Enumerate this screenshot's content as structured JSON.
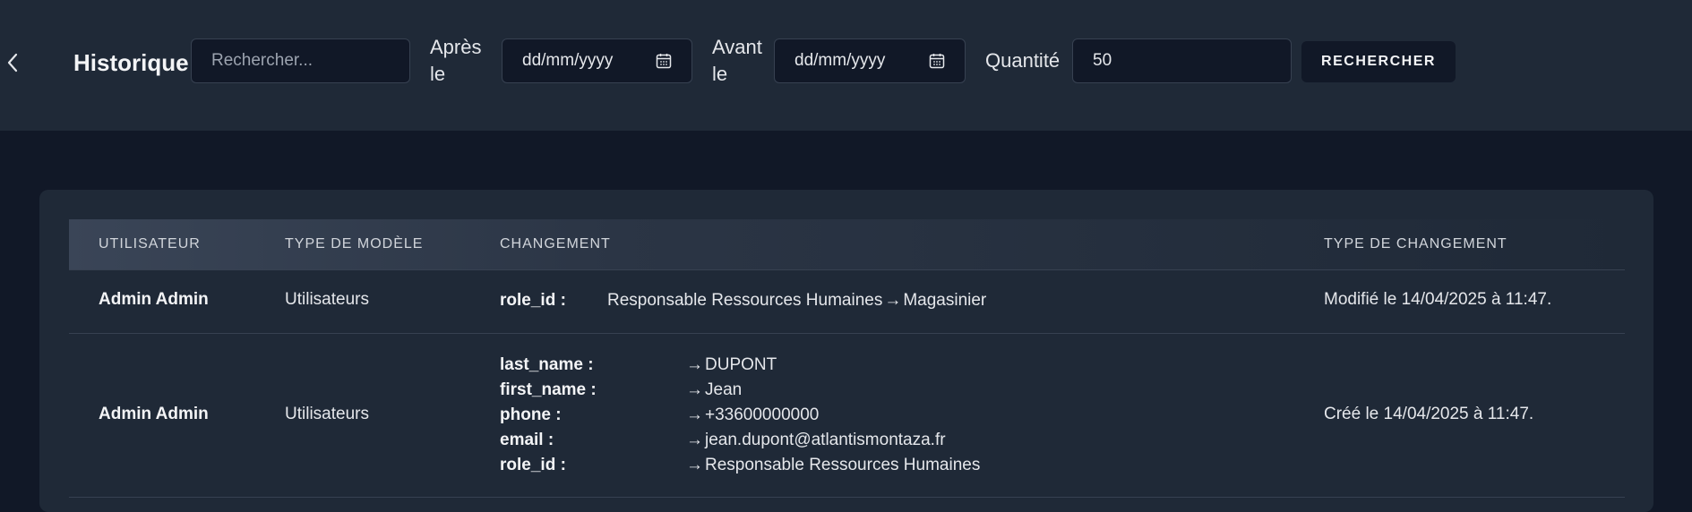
{
  "header": {
    "title": "Historique",
    "search_placeholder": "Rechercher...",
    "after_label_1": "Après",
    "after_label_2": "le",
    "after_date_placeholder": "dd/mm/yyyy",
    "before_label_1": "Avant",
    "before_label_2": "le",
    "before_date_placeholder": "dd/mm/yyyy",
    "quantity_label": "Quantité",
    "quantity_value": "50",
    "search_button": "RECHERCHER"
  },
  "table": {
    "columns": [
      "UTILISATEUR",
      "TYPE DE MODÈLE",
      "CHANGEMENT",
      "TYPE DE CHANGEMENT"
    ],
    "rows": [
      {
        "user": "Admin Admin",
        "model": "Utilisateurs",
        "changes": [
          {
            "key": "role_id :",
            "old": "Responsable Ressources Humaines",
            "arrow": "→",
            "new": "Magasinier"
          }
        ],
        "change_type": "Modifié le 14/04/2025 à 11:47."
      },
      {
        "user": "Admin Admin",
        "model": "Utilisateurs",
        "changes": [
          {
            "key": "last_name :",
            "old": "",
            "arrow": "→",
            "new": "DUPONT"
          },
          {
            "key": "first_name :",
            "old": "",
            "arrow": "→",
            "new": "Jean"
          },
          {
            "key": "phone :",
            "old": "",
            "arrow": "→",
            "new": "+33600000000"
          },
          {
            "key": "email :",
            "old": "",
            "arrow": "→",
            "new": "jean.dupont@atlantismontaza.fr"
          },
          {
            "key": "role_id :",
            "old": "",
            "arrow": "→",
            "new": "Responsable Ressources Humaines"
          }
        ],
        "change_type": "Créé le 14/04/2025 à 11:47."
      }
    ]
  },
  "icons": {
    "back": "chevron-left-icon",
    "calendar": "calendar-icon"
  }
}
